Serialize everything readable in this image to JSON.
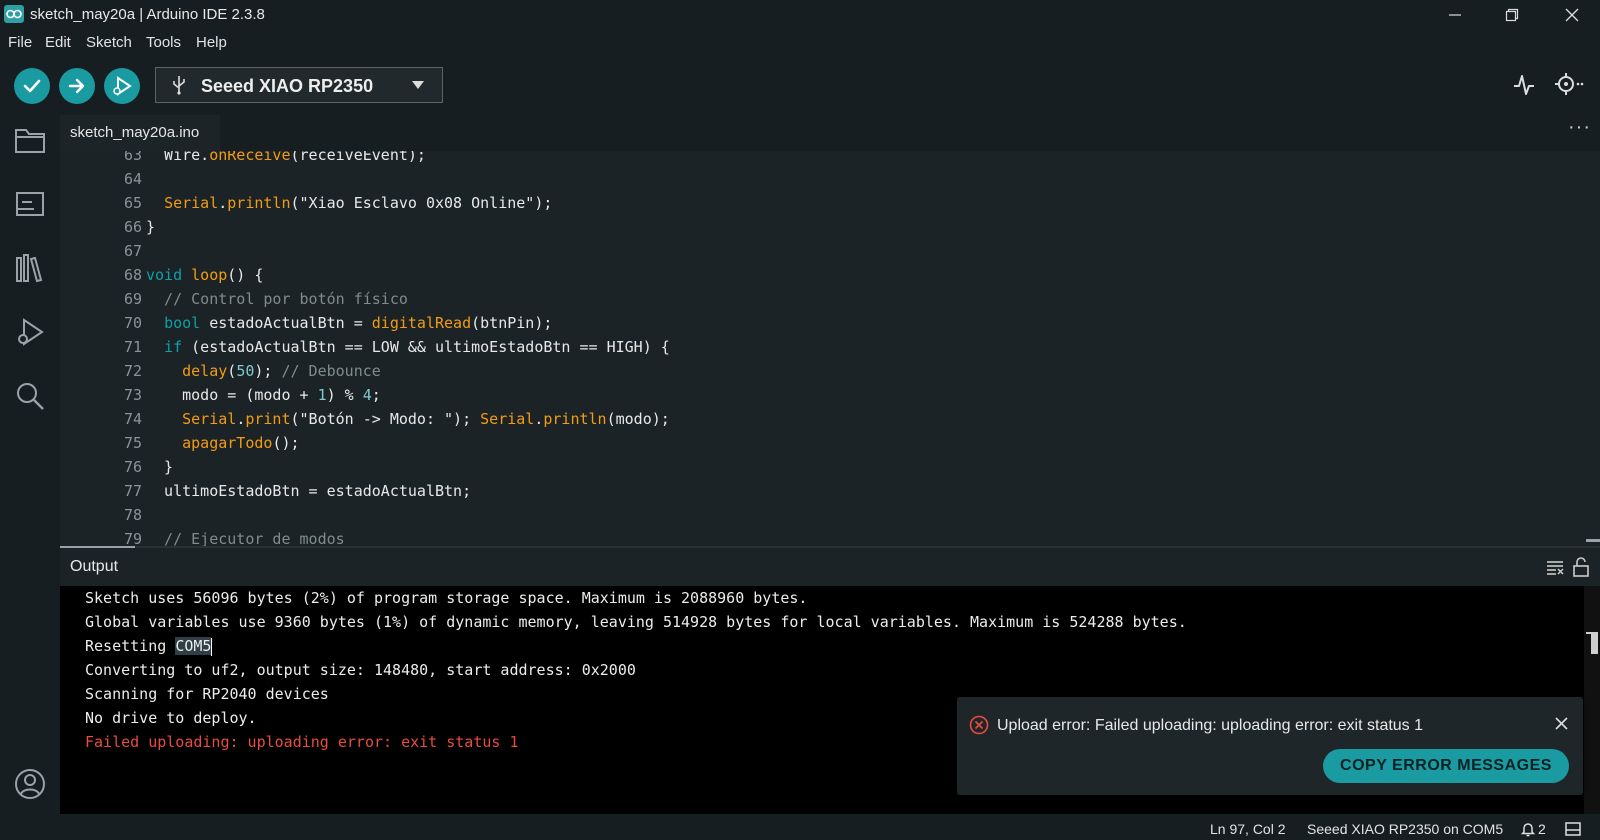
{
  "window": {
    "title": "sketch_may20a | Arduino IDE 2.3.8"
  },
  "menu": [
    "File",
    "Edit",
    "Sketch",
    "Tools",
    "Help"
  ],
  "toolbar": {
    "board": "Seeed XIAO RP2350"
  },
  "tab": {
    "filename": "sketch_may20a.ino"
  },
  "editor": {
    "lines": [
      {
        "n": "63"
      },
      {
        "n": "64"
      },
      {
        "n": "65"
      },
      {
        "n": "66"
      },
      {
        "n": "67"
      },
      {
        "n": "68"
      },
      {
        "n": "69"
      },
      {
        "n": "70"
      },
      {
        "n": "71"
      },
      {
        "n": "72"
      },
      {
        "n": "73"
      },
      {
        "n": "74"
      },
      {
        "n": "75"
      },
      {
        "n": "76"
      },
      {
        "n": "77"
      },
      {
        "n": "78"
      },
      {
        "n": "79"
      }
    ],
    "code": {
      "l63a": "  Wire.",
      "l63b": "onReceive",
      "l63c": "(receiveEvent);",
      "l65a": "  ",
      "l65b": "Serial",
      "l65c": ".",
      "l65d": "println",
      "l65e": "(\"Xiao Esclavo 0x08 Online\");",
      "l66": "}",
      "l68a": "void",
      "l68b": " ",
      "l68c": "loop",
      "l68d": "() {",
      "l69": "  // Control por botón físico",
      "l70a": "  ",
      "l70b": "bool",
      "l70c": " estadoActualBtn = ",
      "l70d": "digitalRead",
      "l70e": "(btnPin);",
      "l71a": "  ",
      "l71b": "if",
      "l71c": " (estadoActualBtn == LOW && ultimoEstadoBtn == HIGH) {",
      "l72a": "    ",
      "l72b": "delay",
      "l72c": "(",
      "l72d": "50",
      "l72e": "); ",
      "l72f": "// Debounce",
      "l73a": "    modo = (modo + ",
      "l73b": "1",
      "l73c": ") % ",
      "l73d": "4",
      "l73e": ";",
      "l74a": "    ",
      "l74b": "Serial",
      "l74c": ".",
      "l74d": "print",
      "l74e": "(\"Botón -> Modo: \"); ",
      "l74f": "Serial",
      "l74g": ".",
      "l74h": "println",
      "l74i": "(modo);",
      "l75a": "    ",
      "l75b": "apagarTodo",
      "l75c": "();",
      "l76": "  }",
      "l77": "  ultimoEstadoBtn = estadoActualBtn;",
      "l79": "  // Ejecutor de modos"
    }
  },
  "output": {
    "title": "Output",
    "lines": [
      "Sketch uses 56096 bytes (2%) of program storage space. Maximum is 2088960 bytes.",
      "Global variables use 9360 bytes (1%) of dynamic memory, leaving 514928 bytes for local variables. Maximum is 524288 bytes.",
      "Resetting ",
      "Converting to uf2, output size: 148480, start address: 0x2000",
      "Scanning for RP2040 devices",
      "No drive to deploy.",
      "Failed uploading: uploading error: exit status 1"
    ],
    "selected": "COM5"
  },
  "notification": {
    "message": "Upload error: Failed uploading: uploading error: exit status 1",
    "button": "COPY ERROR MESSAGES"
  },
  "status": {
    "cursor": "Ln 97, Col 2",
    "board": "Seeed XIAO RP2350 on COM5",
    "notifications": "2"
  },
  "colors": {
    "accent": "#1a9ba1",
    "error": "#e74c3c",
    "keyword": "#0ca1a6",
    "function": "#f39c12"
  }
}
